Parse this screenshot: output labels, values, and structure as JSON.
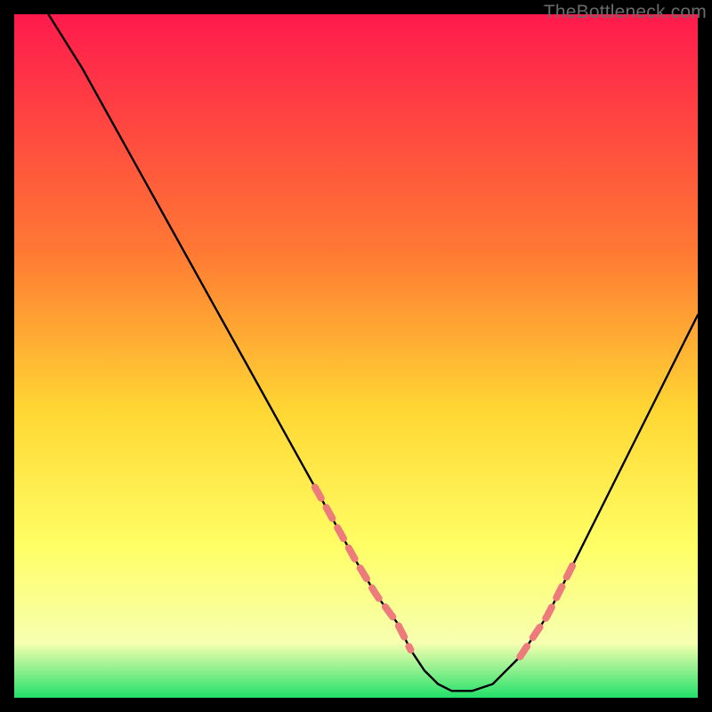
{
  "watermark": "TheBottleneck.com",
  "colors": {
    "black": "#000000",
    "curve": "#000000",
    "dash": "#ed7b7b",
    "grad_top": "#ff1a4d",
    "grad_mid1": "#ff7a33",
    "grad_mid2": "#ffd733",
    "grad_low1": "#ffff66",
    "grad_low2": "#f6ffb0",
    "grad_bottom": "#22e06a"
  },
  "chart_data": {
    "type": "line",
    "title": "",
    "xlabel": "",
    "ylabel": "",
    "xlim": [
      0,
      100
    ],
    "ylim": [
      0,
      100
    ],
    "series": [
      {
        "name": "curve",
        "x": [
          5,
          10,
          15,
          20,
          25,
          30,
          35,
          40,
          45,
          50,
          53,
          56,
          58,
          60,
          62,
          64,
          67,
          70,
          74,
          78,
          82,
          86,
          90,
          94,
          98,
          100
        ],
        "y": [
          100,
          92,
          83,
          74,
          65,
          56,
          47,
          38,
          29,
          20,
          15,
          11,
          7,
          4,
          2,
          1,
          1,
          2,
          6,
          12,
          20,
          28,
          36,
          44,
          52,
          56
        ]
      }
    ],
    "dash_ranges_x": [
      [
        44,
        58
      ],
      [
        74,
        82
      ]
    ],
    "annotations": []
  }
}
